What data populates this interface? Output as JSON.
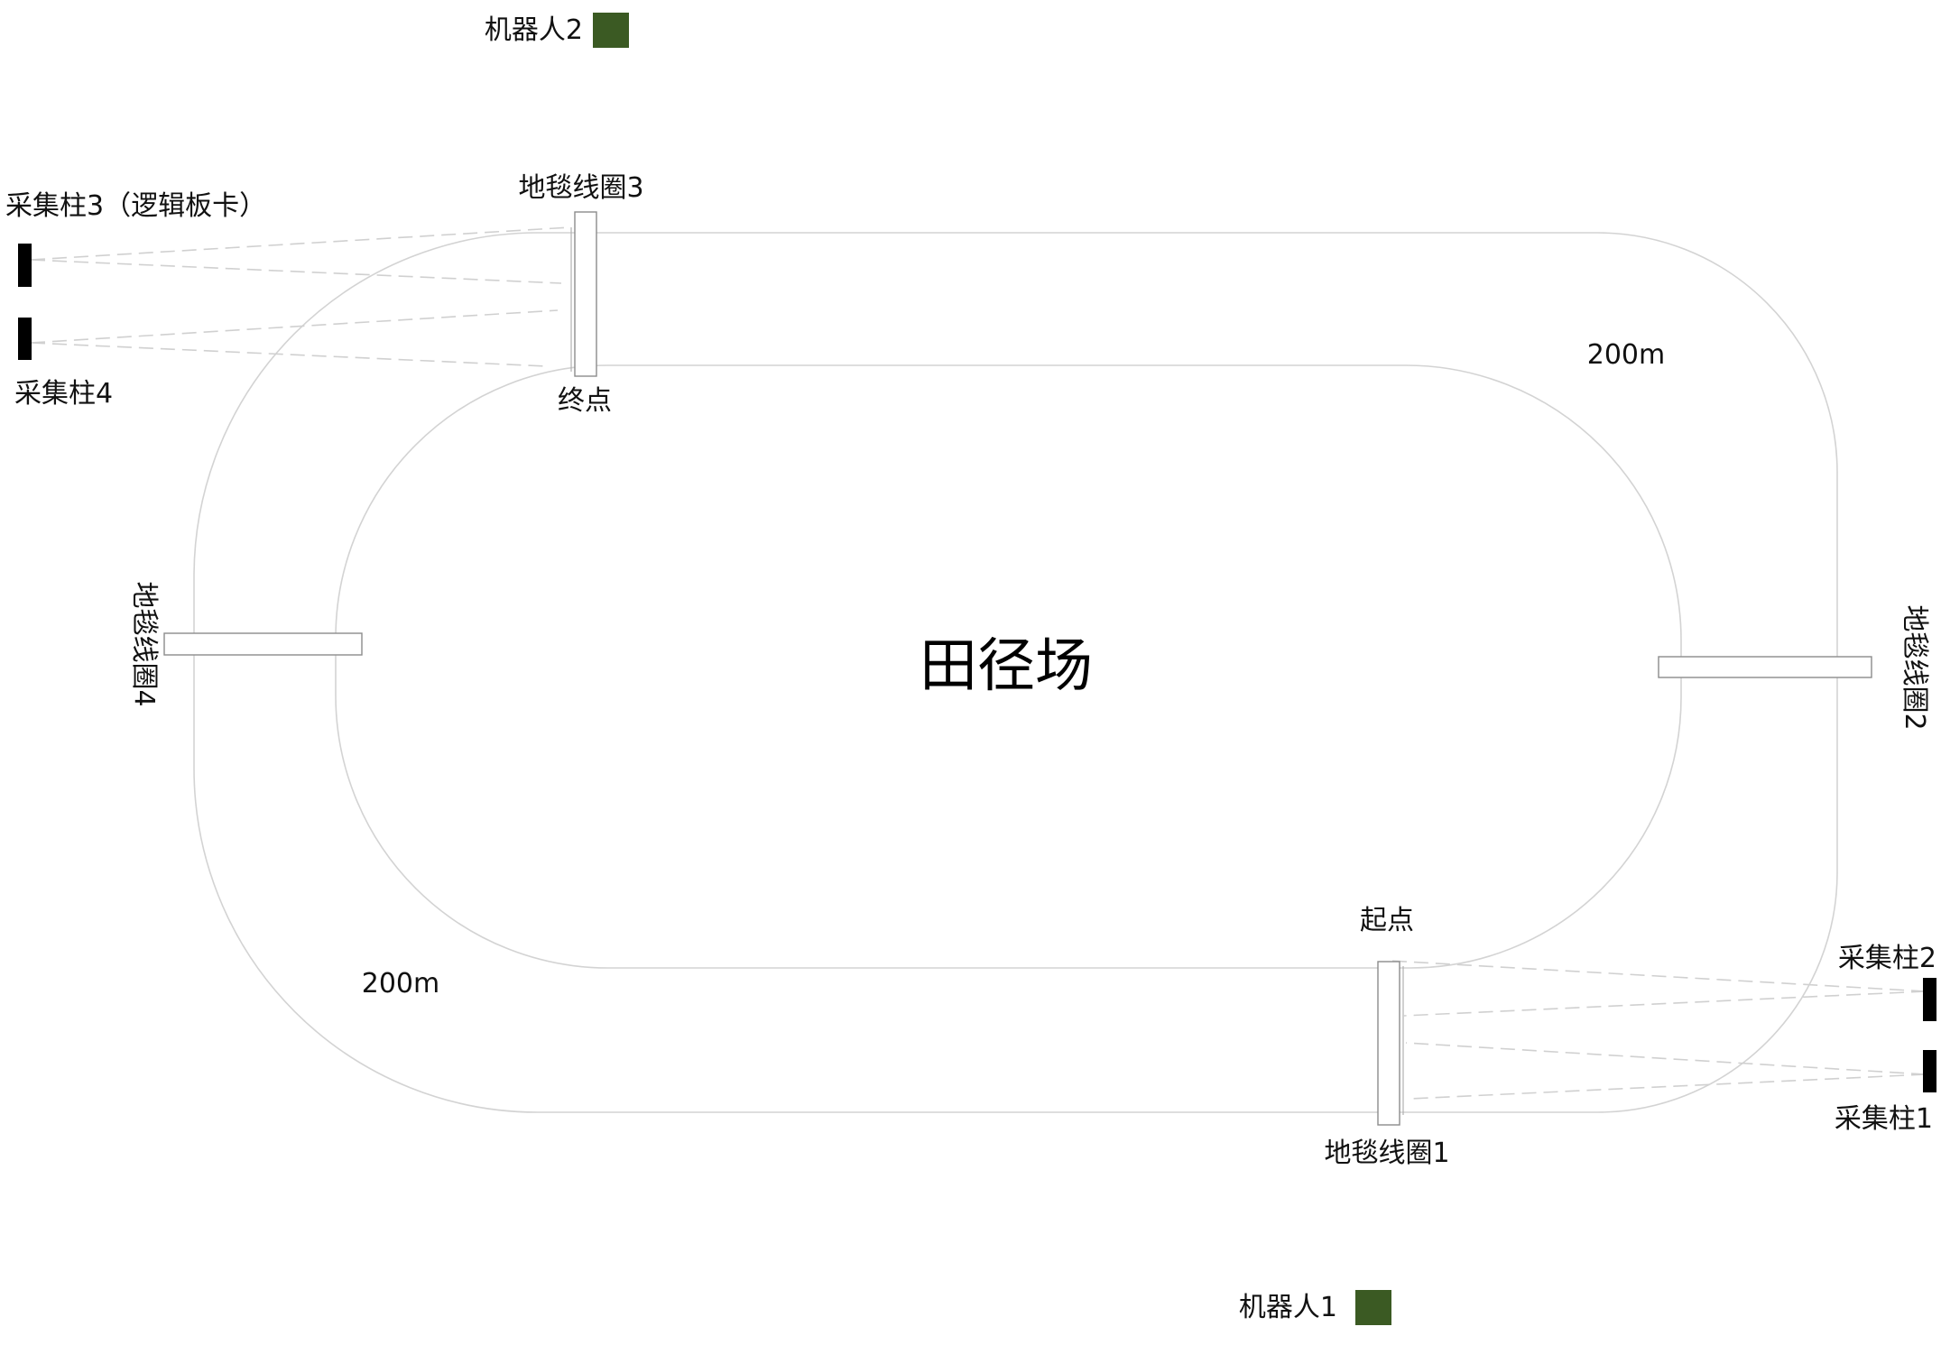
{
  "field": {
    "title": "田径场",
    "straight_length_top": "200m",
    "straight_length_bottom": "200m"
  },
  "points": {
    "start": "起点",
    "finish": "终点"
  },
  "loops": {
    "loop1": "地毯线圈1",
    "loop2": "地毯线圈2",
    "loop3": "地毯线圈3",
    "loop4": "地毯线圈4"
  },
  "pillars": {
    "pillar1": "采集柱1",
    "pillar2": "采集柱2",
    "pillar3": "采集柱3（逻辑板卡）",
    "pillar4": "采集柱4"
  },
  "robots": {
    "robot1": "机器人1",
    "robot2": "机器人2"
  },
  "colors": {
    "robot": "#3b5a23",
    "pillar": "#000000",
    "track_line": "#d3d3d3"
  }
}
